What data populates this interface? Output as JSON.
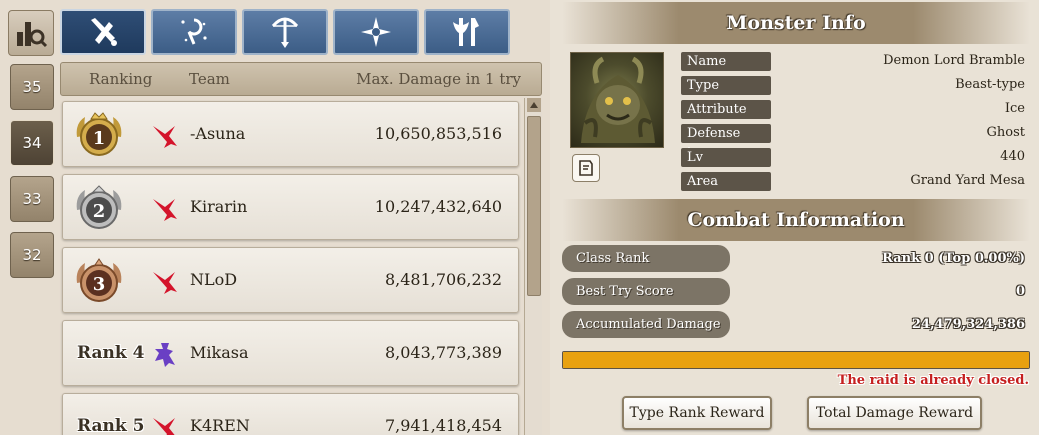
{
  "floors": [
    {
      "label": "35",
      "active": false
    },
    {
      "label": "34",
      "active": true
    },
    {
      "label": "33",
      "active": false
    },
    {
      "label": "32",
      "active": false
    }
  ],
  "class_tabs": [
    {
      "icon": "swordsman-class-icon",
      "active": true
    },
    {
      "icon": "mage-class-icon",
      "active": false
    },
    {
      "icon": "archer-class-icon",
      "active": false
    },
    {
      "icon": "healer-class-icon",
      "active": false
    },
    {
      "icon": "warrior-class-icon",
      "active": false
    }
  ],
  "ranking": {
    "headers": {
      "rank": "Ranking",
      "team": "Team",
      "damage": "Max. Damage in 1 try"
    },
    "rows": [
      {
        "rank": "1",
        "rank_label": "",
        "medal": "gold",
        "team": "-Asuna",
        "damage": "10,650,853,516",
        "class_icon": "swordsman-class-icon"
      },
      {
        "rank": "2",
        "rank_label": "",
        "medal": "silver",
        "team": "Kirarin",
        "damage": "10,247,432,640",
        "class_icon": "swordsman-class-icon"
      },
      {
        "rank": "3",
        "rank_label": "",
        "medal": "bronze",
        "team": "NLoD",
        "damage": "8,481,706,232",
        "class_icon": "swordsman-class-icon"
      },
      {
        "rank": "4",
        "rank_label": "Rank 4",
        "medal": "none",
        "team": "Mikasa",
        "damage": "8,043,773,389",
        "class_icon": "ninja-class-icon"
      },
      {
        "rank": "5",
        "rank_label": "Rank 5",
        "medal": "none",
        "team": "K4REN",
        "damage": "7,941,418,454",
        "class_icon": "swordsman-class-icon"
      }
    ]
  },
  "monster": {
    "title": "Monster Info",
    "fields": [
      {
        "label": "Name",
        "value": "Demon Lord Bramble"
      },
      {
        "label": "Type",
        "value": "Beast-type"
      },
      {
        "label": "Attribute",
        "value": "Ice"
      },
      {
        "label": "Defense type",
        "value": "Ghost"
      },
      {
        "label": "Lv",
        "value": "440"
      },
      {
        "label": "Area",
        "value": "Grand Yard Mesa"
      }
    ]
  },
  "combat": {
    "title": "Combat Information",
    "fields": [
      {
        "label": "Class Rank",
        "value": "Rank 0 (Top 0.00%)"
      },
      {
        "label": "Best Try Score",
        "value": "0"
      },
      {
        "label": "Accumulated Damage",
        "value": "24,479,324,386"
      }
    ],
    "progress": 1.0,
    "status": "The raid is already closed."
  },
  "buttons": {
    "type_rank_reward": "Type Rank Reward",
    "total_damage_reward": "Total Damage Reward"
  },
  "colors": {
    "progress": "#e8a10f",
    "status": "#c51f1f",
    "class_accent": "#d4142b",
    "ninja_accent": "#6a3fc4"
  }
}
